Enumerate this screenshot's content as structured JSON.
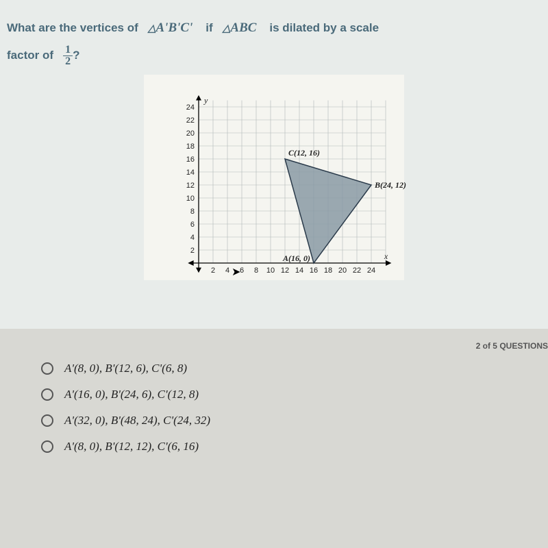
{
  "question": {
    "part1": "What are the vertices of",
    "expr1_tri": "△",
    "expr1": "A'B'C'",
    "part2": "if",
    "expr2_tri": "△",
    "expr2": "ABC",
    "part3": "is dilated by a scale",
    "part4": "factor of",
    "frac_num": "1",
    "frac_den": "2",
    "part5": "?"
  },
  "chart_data": {
    "type": "scatter",
    "title": "",
    "xlabel": "x",
    "ylabel": "y",
    "xlim": [
      0,
      26
    ],
    "ylim": [
      0,
      25
    ],
    "x_ticks": [
      2,
      4,
      6,
      8,
      10,
      12,
      14,
      16,
      18,
      20,
      22,
      24
    ],
    "y_ticks": [
      2,
      4,
      6,
      8,
      10,
      12,
      14,
      16,
      18,
      20,
      22,
      24
    ],
    "points": [
      {
        "label": "A(16, 0)",
        "x": 16,
        "y": 0
      },
      {
        "label": "B(24, 12)",
        "x": 24,
        "y": 12
      },
      {
        "label": "C(12, 16)",
        "x": 12,
        "y": 16
      }
    ],
    "triangle": [
      [
        16,
        0
      ],
      [
        24,
        12
      ],
      [
        12,
        16
      ]
    ]
  },
  "counter": "2 of 5 QUESTIONS",
  "options": [
    "A'(8, 0), B'(12, 6), C'(6, 8)",
    "A'(16, 0), B'(24, 6), C'(12, 8)",
    "A'(32, 0), B'(48, 24), C'(24, 32)",
    "A'(8, 0), B'(12, 12), C'(6, 16)"
  ]
}
